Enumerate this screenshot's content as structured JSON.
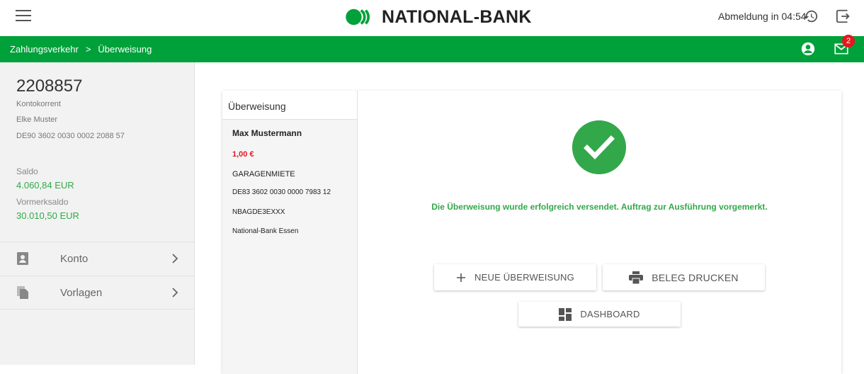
{
  "header": {
    "brand": "NATIONAL-BANK",
    "logout_timer": "Abmeldung in 04:54",
    "icons": [
      "menu-icon",
      "history-icon",
      "logout-icon"
    ]
  },
  "nav": {
    "breadcrumb": [
      "Zahlungsverkehr",
      ">",
      "Überweisung"
    ],
    "mail_badge": "2",
    "icons": [
      "user-icon",
      "mail-icon"
    ]
  },
  "sidebar": {
    "account_number": "2208857",
    "account_type": "Kontokorrent",
    "owner": "Elke Muster",
    "iban": "DE90 3602 0030 0002 2088 57",
    "saldo_label": "Saldo",
    "saldo_value": "4.060,84 EUR",
    "vormerk_label": "Vormerksaldo",
    "vormerk_value": "30.010,50 EUR",
    "items": [
      {
        "label": "Konto",
        "icon": "account-icon"
      },
      {
        "label": "Vorlagen",
        "icon": "templates-icon"
      }
    ]
  },
  "summary": {
    "title": "Überweisung",
    "recipient": "Max Mustermann",
    "amount": "1,00 €",
    "reference": "GARAGENMIETE",
    "iban": "DE83 3602 0030 0000 7983 12",
    "bic": "NBAGDE3EXXX",
    "bank": "National-Bank Essen"
  },
  "result": {
    "message": "Die Überweisung wurde erfolgreich versendet. Auftrag zur Ausführung vorgemerkt.",
    "buttons": {
      "new_transfer": "NEUE ÜBERWEISUNG",
      "print_receipt": "BELEG DRUCKEN",
      "dashboard": "DASHBOARD"
    }
  },
  "colors": {
    "brand_green": "#00a13a",
    "success_green": "#33a84a",
    "amount_red": "#e6171f"
  }
}
